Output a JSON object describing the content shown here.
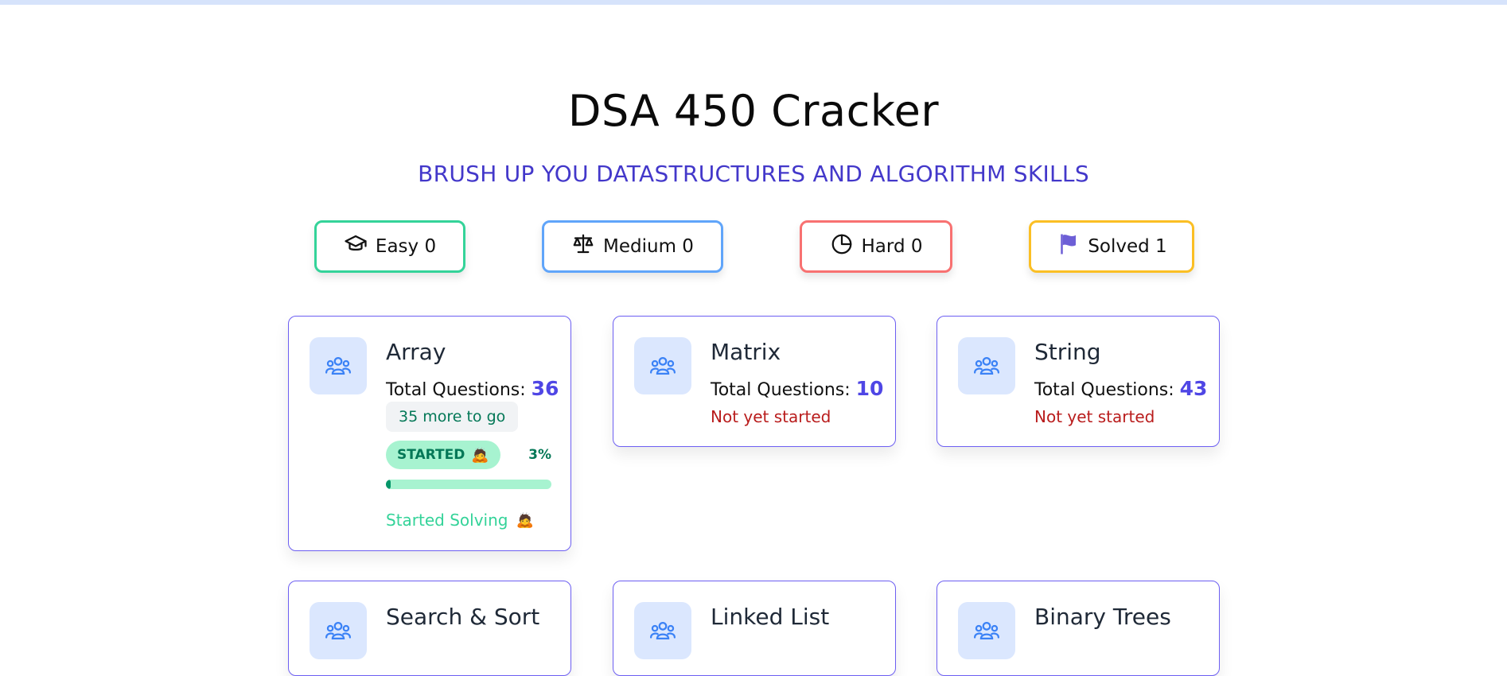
{
  "header": {
    "title": "DSA 450 Cracker",
    "subtitle": "BRUSH UP YOU DATASTRUCTURES AND ALGORITHM SKILLS"
  },
  "stats": {
    "easy": {
      "label": "Easy 0",
      "icon": "graduation-cap-icon",
      "color": "#34d399"
    },
    "medium": {
      "label": "Medium 0",
      "icon": "balance-scale-icon",
      "color": "#60a5fa"
    },
    "hard": {
      "label": "Hard 0",
      "icon": "pie-chart-icon",
      "color": "#f87171"
    },
    "solved": {
      "label": "Solved 1",
      "icon": "flag-icon",
      "color": "#fbbf24"
    }
  },
  "topics": [
    {
      "title": "Array",
      "total_label": "Total Questions: ",
      "total": "36",
      "remaining": "35 more to go",
      "status": "STARTED",
      "status_emoji": "🙇",
      "percent_label": "3%",
      "progress": 0.03,
      "footer": "Started Solving",
      "footer_emoji": "🙇"
    },
    {
      "title": "Matrix",
      "total_label": "Total Questions: ",
      "total": "10",
      "state": "Not yet started"
    },
    {
      "title": "String",
      "total_label": "Total Questions: ",
      "total": "43",
      "state": "Not yet started"
    },
    {
      "title": "Search & Sort"
    },
    {
      "title": "Linked List"
    },
    {
      "title": "Binary Trees"
    }
  ],
  "colors": {
    "accent": "#4f46e5",
    "subtitle": "#4338ca",
    "card_border": "#6d5ff2",
    "icon_bg": "#dbe7fe",
    "not_started": "#b91c1c",
    "started": "#047857"
  }
}
